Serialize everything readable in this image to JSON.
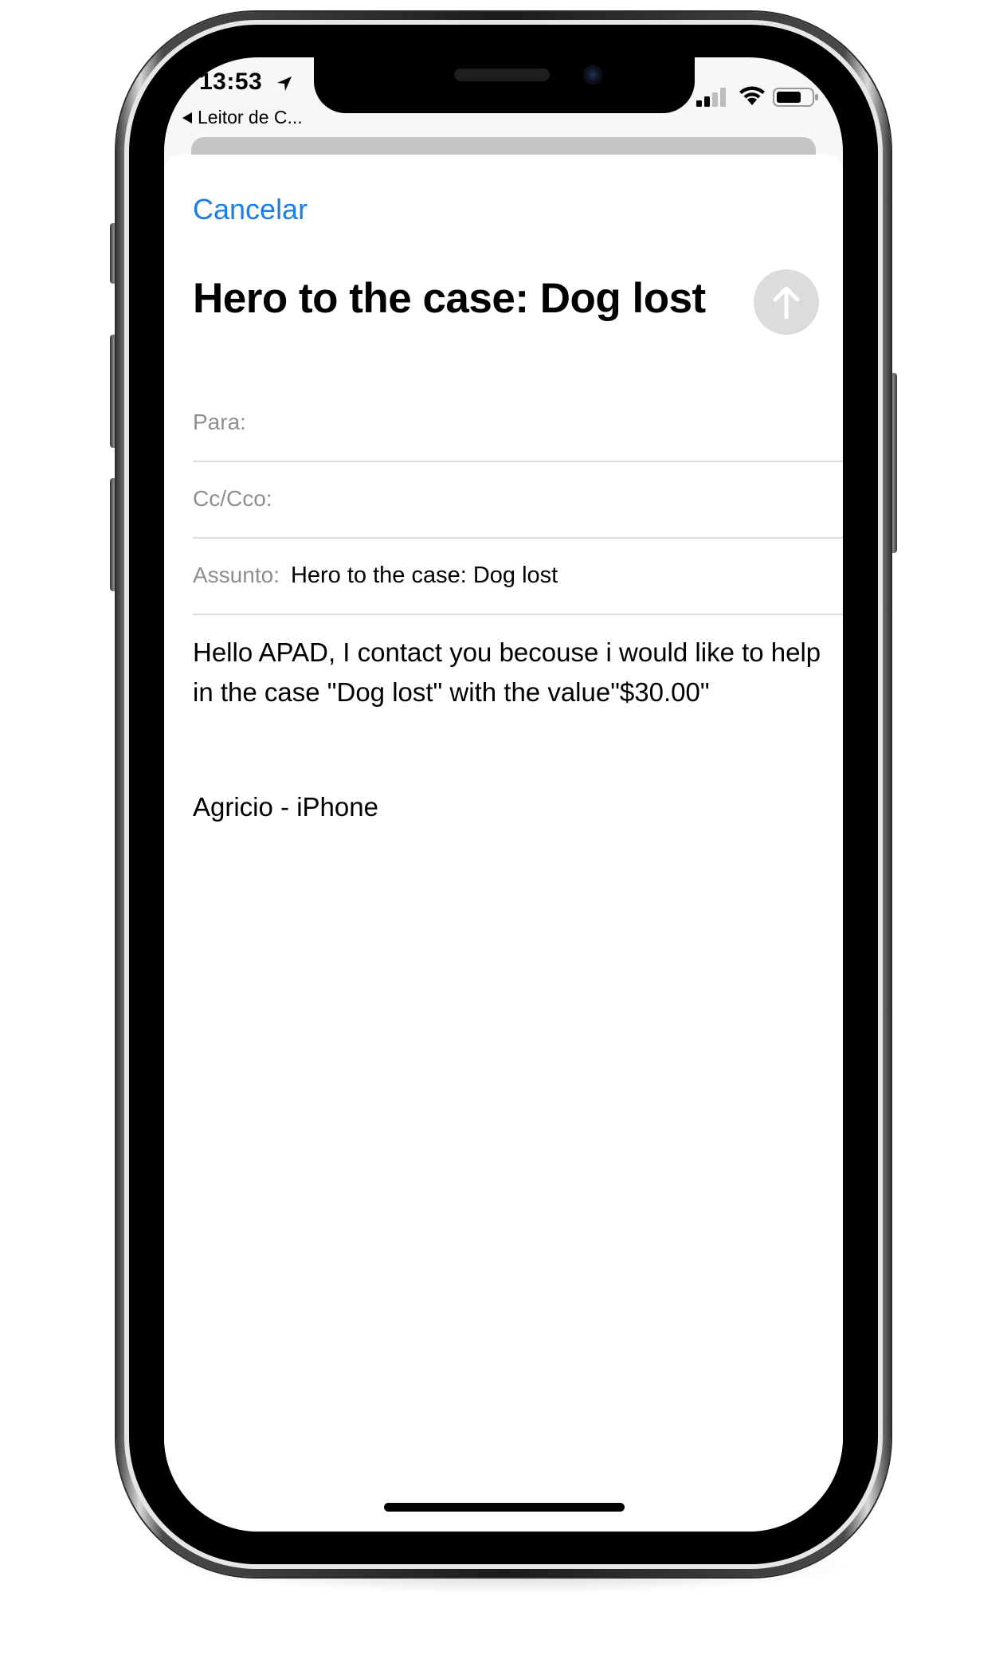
{
  "status_bar": {
    "time": "13:53",
    "back_app": "Leitor de C..."
  },
  "compose": {
    "cancel_label": "Cancelar",
    "title": "Hero to the case: Dog lost",
    "to_label": "Para:",
    "cc_label": "Cc/Cco:",
    "subject_label": "Assunto:",
    "subject_value": "Hero to the case: Dog lost",
    "body": "Hello APAD, I contact you becouse i would like to help in the case \"Dog lost\" with the value\"$30.00\"",
    "signature": "Agricio - iPhone"
  },
  "colors": {
    "accent": "#1a7ee6",
    "label_gray": "#8e8e93",
    "send_button_disabled": "#dcdcdc"
  },
  "icons": {
    "location": "location-arrow-icon",
    "back": "back-triangle-icon",
    "signal": "cellular-signal-icon",
    "wifi": "wifi-icon",
    "battery": "battery-icon",
    "send": "arrow-up-icon"
  }
}
